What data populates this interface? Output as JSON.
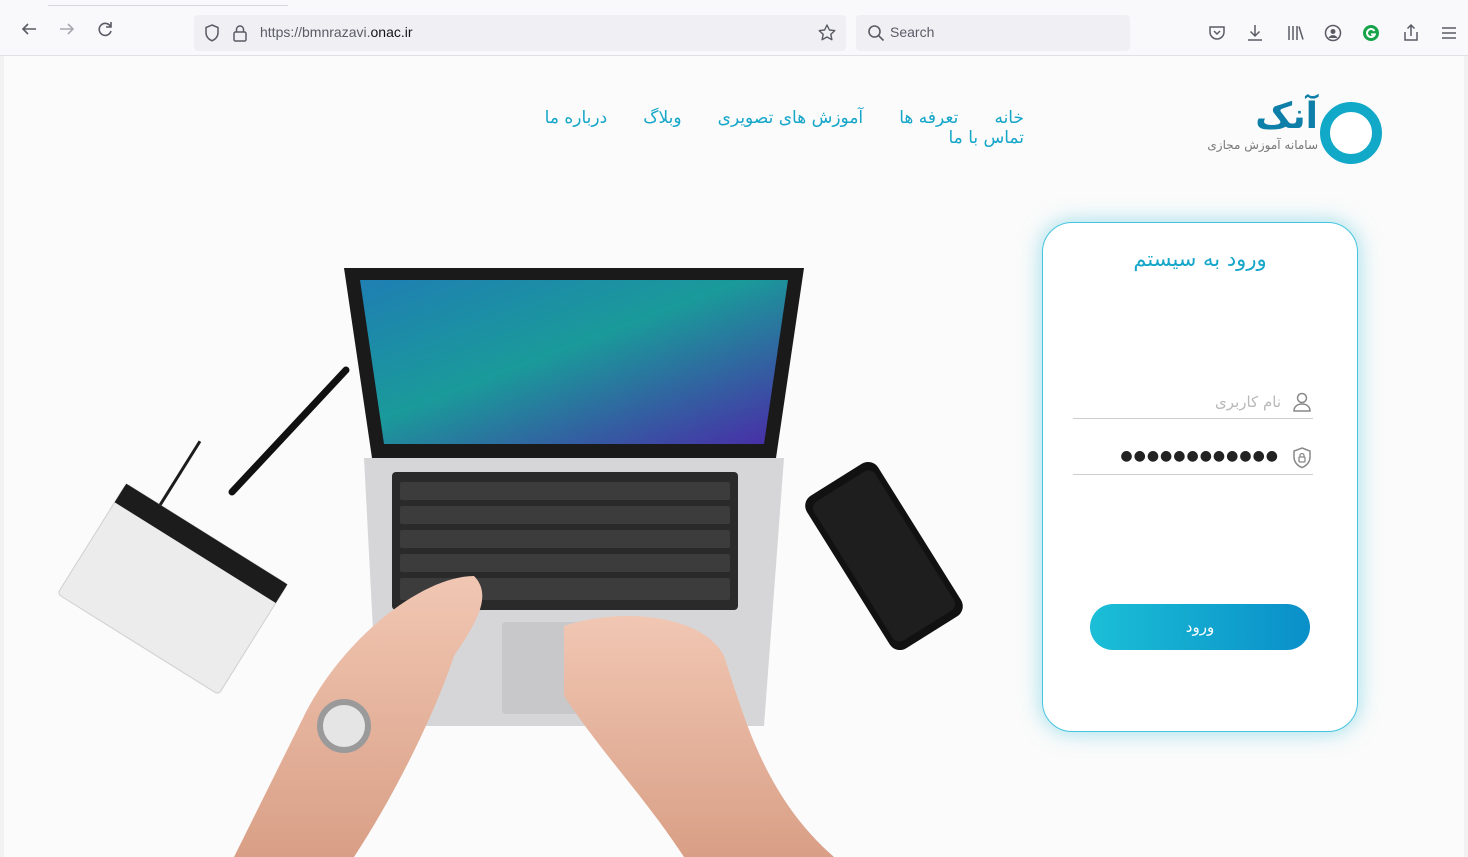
{
  "browser": {
    "url_prefix": "https://bmnrazavi.",
    "url_domain": "onac.ir",
    "search_placeholder": "Search",
    "icons": [
      "back-icon",
      "forward-icon",
      "reload-icon",
      "shield-icon",
      "lock-icon",
      "star-icon",
      "search-icon",
      "pocket-icon",
      "download-icon",
      "library-icon",
      "account-icon",
      "extension-icon",
      "share-icon",
      "menu-icon"
    ]
  },
  "site": {
    "logo_text": "آنک",
    "logo_subtitle": "سامانه آموزش مجازی",
    "nav": [
      "خانه",
      "تعرفه ها",
      "آموزش های تصویری",
      "وبلاگ",
      "درباره ما",
      "تماس با ما"
    ]
  },
  "login": {
    "title": "ورود به سیستم",
    "username_placeholder": "نام کاربری",
    "password_value": "●●●●●●●●●●●●",
    "submit_label": "ورود"
  },
  "colors": {
    "accent": "#15a6c9",
    "logo_dark": "#0e7fa8",
    "button_start": "#1bbfd6",
    "button_end": "#0a8fc9"
  }
}
